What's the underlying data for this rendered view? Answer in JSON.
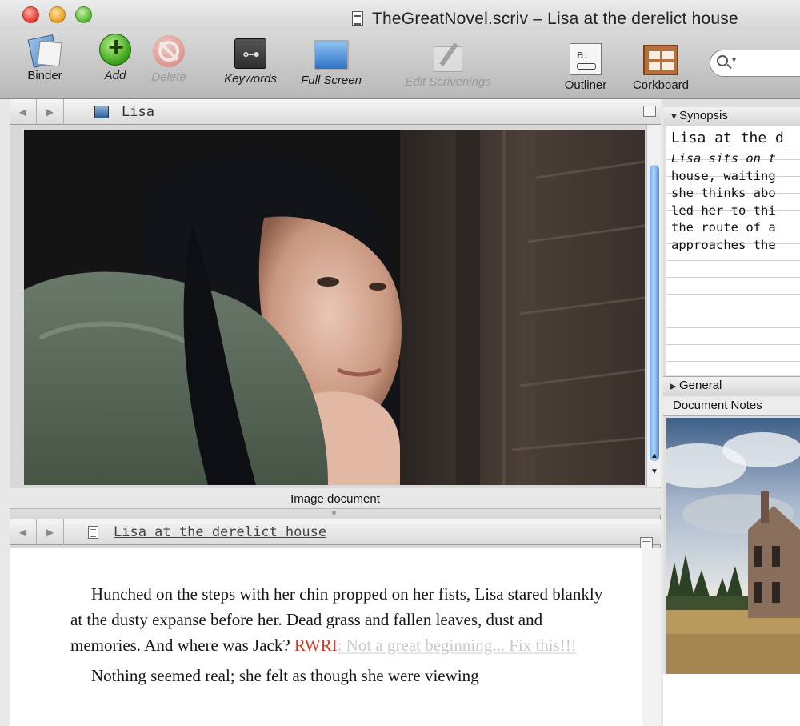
{
  "window": {
    "title": "TheGreatNovel.scriv – Lisa at the derelict house"
  },
  "toolbar": {
    "binder": "Binder",
    "add": "Add",
    "delete": "Delete",
    "keywords": "Keywords",
    "full_screen": "Full Screen",
    "edit_scrivenings": "Edit Scrivenings",
    "outliner": "Outliner",
    "corkboard": "Corkboard",
    "search_placeholder": ""
  },
  "top_editor": {
    "nav_back": "◀",
    "nav_forward": "▶",
    "title": "Lisa",
    "caption": "Image document",
    "scroll_up": "▲",
    "scroll_down": "▼"
  },
  "bottom_editor": {
    "nav_back": "◀",
    "nav_forward": "▶",
    "title": "Lisa at the derelict house",
    "paragraph1_text": "Hunched on the steps with her chin propped on her fists, Lisa stared blankly at the dusty expanse before her. Dead grass and fallen leaves, dust and memories. And where was Jack? ",
    "annotation_tag": "RWRI",
    "annotation_text": ": Not a great beginning... Fix this!!!",
    "paragraph2_text": "Nothing seemed real; she felt as though she were viewing"
  },
  "inspector": {
    "synopsis_label": "Synopsis",
    "synopsis_title": "Lisa at the d",
    "synopsis_lines": [
      "Lisa sits on t",
      "house, waiting",
      "she thinks abo",
      "led her to thi",
      "the route of a",
      "approaches the"
    ],
    "general_label": "General",
    "document_notes_label": "Document Notes"
  },
  "colors": {
    "annotation_red": "#d23b2a",
    "scroll_blue": "#6aa4ea"
  },
  "icons": [
    "binder-icon",
    "add-icon",
    "delete-icon",
    "keywords-icon",
    "full-screen-icon",
    "edit-scrivenings-icon",
    "outliner-icon",
    "corkboard-icon",
    "search-icon",
    "image-document-icon",
    "text-document-icon"
  ]
}
